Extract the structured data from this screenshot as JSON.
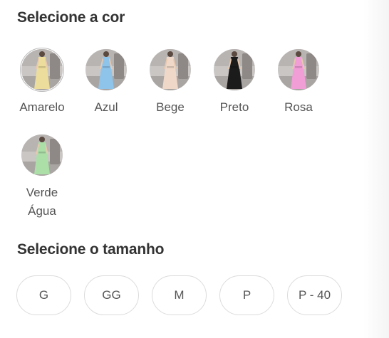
{
  "color_section": {
    "title": "Selecione a cor",
    "selected": "Amarelo",
    "options": [
      {
        "label": "Amarelo",
        "color": "#ecdd9c"
      },
      {
        "label": "Azul",
        "color": "#8fc4ea"
      },
      {
        "label": "Bege",
        "color": "#efd8c8"
      },
      {
        "label": "Preto",
        "color": "#1b1b1b"
      },
      {
        "label": "Rosa",
        "color": "#f19ed6"
      },
      {
        "label": "Verde Água",
        "color": "#acdfa8"
      }
    ]
  },
  "size_section": {
    "title": "Selecione o tamanho",
    "options": [
      "G",
      "GG",
      "M",
      "P",
      "P - 40"
    ]
  }
}
